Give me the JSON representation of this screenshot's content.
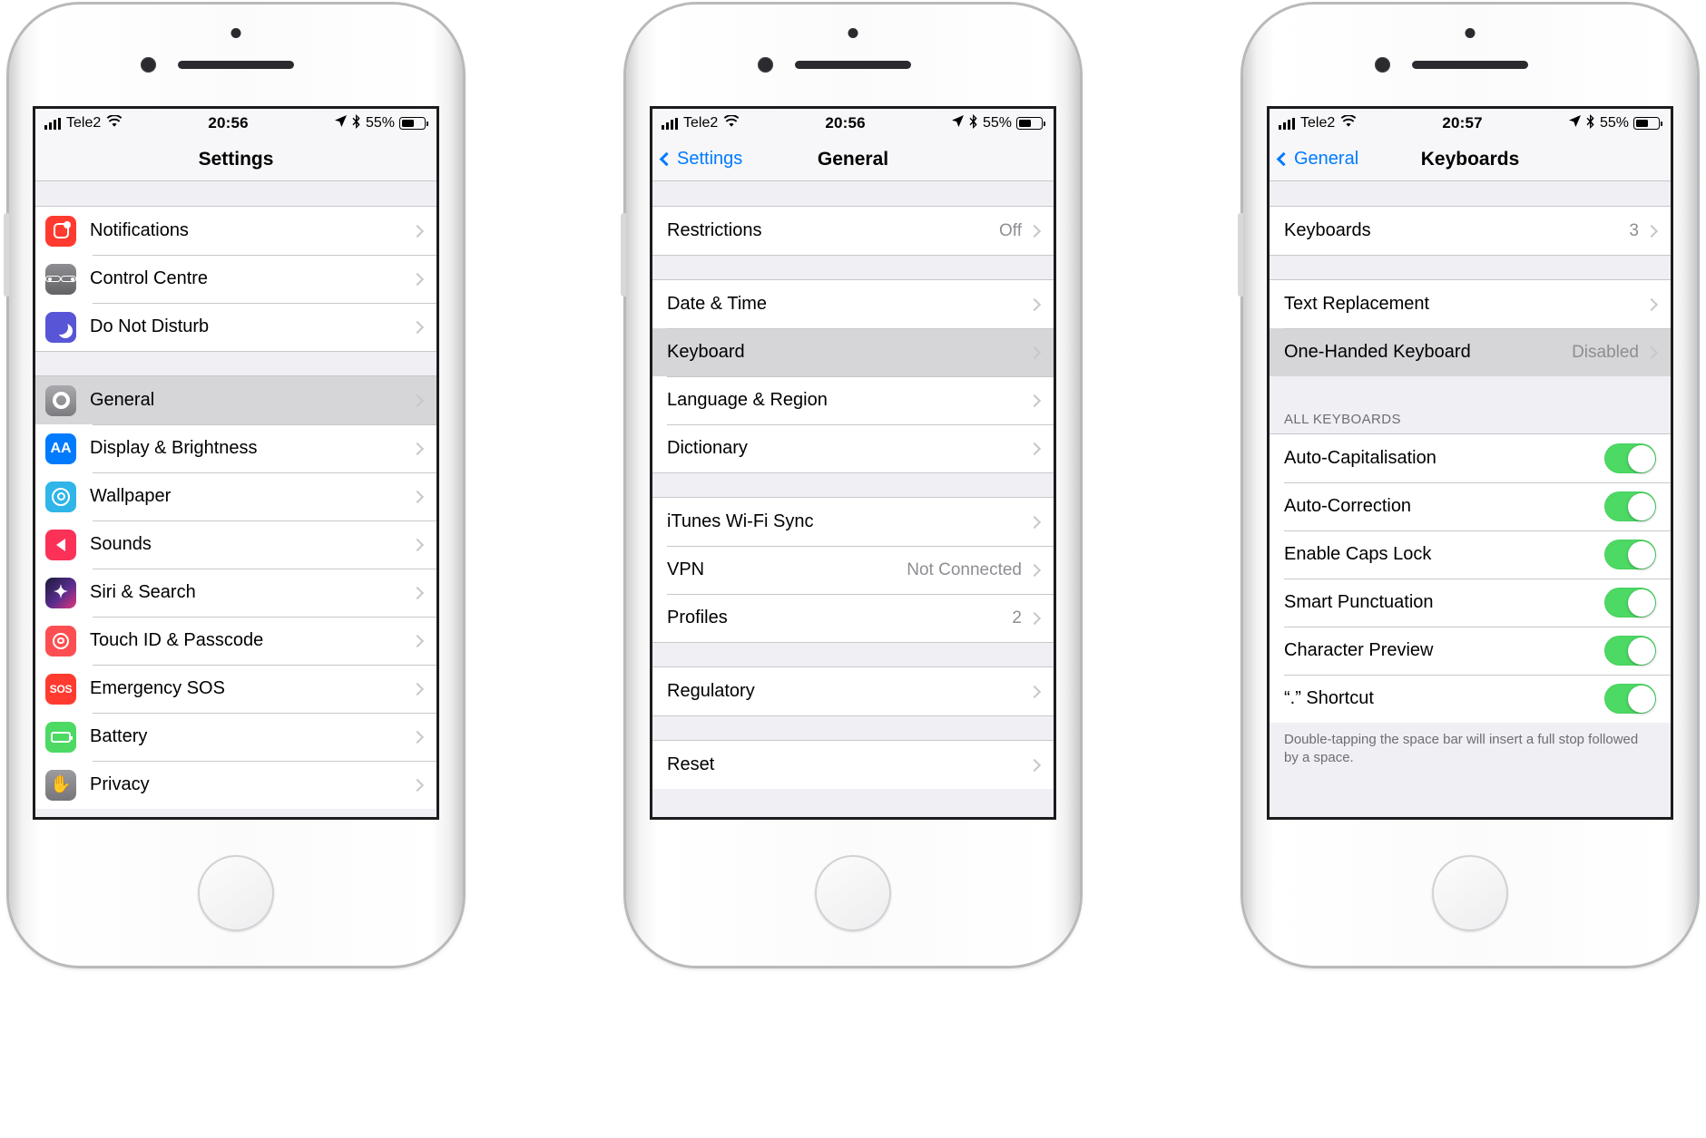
{
  "phones": [
    {
      "id": "settings",
      "status": {
        "carrier": "Tele2",
        "time": "20:56",
        "battery_pct": "55%",
        "signal_icon": "signal-bars-icon",
        "wifi_icon": "wifi-icon",
        "location_icon": "location-arrow-icon",
        "bluetooth_icon": "bluetooth-icon",
        "battery_icon": "battery-icon"
      },
      "nav": {
        "title": "Settings",
        "back_label": ""
      },
      "sections": [
        {
          "rows": [
            {
              "label": "Notifications",
              "icon": "notifications-icon",
              "icon_class": "ic-notif",
              "value": "",
              "chevron": true
            },
            {
              "label": "Control Centre",
              "icon": "control-centre-icon",
              "icon_class": "ic-control",
              "value": "",
              "chevron": true
            },
            {
              "label": "Do Not Disturb",
              "icon": "do-not-disturb-icon",
              "icon_class": "ic-dnd",
              "value": "",
              "chevron": true
            }
          ]
        },
        {
          "rows": [
            {
              "label": "General",
              "icon": "general-gear-icon",
              "icon_class": "ic-general",
              "value": "",
              "chevron": true,
              "selected": true
            },
            {
              "label": "Display & Brightness",
              "icon": "display-brightness-icon",
              "icon_class": "ic-display",
              "value": "",
              "chevron": true
            },
            {
              "label": "Wallpaper",
              "icon": "wallpaper-icon",
              "icon_class": "ic-wall",
              "value": "",
              "chevron": true
            },
            {
              "label": "Sounds",
              "icon": "sounds-icon",
              "icon_class": "ic-sounds",
              "value": "",
              "chevron": true
            },
            {
              "label": "Siri & Search",
              "icon": "siri-search-icon",
              "icon_class": "ic-siri",
              "value": "",
              "chevron": true
            },
            {
              "label": "Touch ID & Passcode",
              "icon": "touch-id-icon",
              "icon_class": "ic-touch",
              "value": "",
              "chevron": true
            },
            {
              "label": "Emergency SOS",
              "icon": "emergency-sos-icon",
              "icon_class": "ic-sos",
              "value": "",
              "chevron": true
            },
            {
              "label": "Battery",
              "icon": "battery-settings-icon",
              "icon_class": "ic-battery",
              "value": "",
              "chevron": true
            },
            {
              "label": "Privacy",
              "icon": "privacy-hand-icon",
              "icon_class": "ic-privacy",
              "value": "",
              "chevron": true
            }
          ]
        }
      ]
    },
    {
      "id": "general",
      "status": {
        "carrier": "Tele2",
        "time": "20:56",
        "battery_pct": "55%"
      },
      "nav": {
        "title": "General",
        "back_label": "Settings"
      },
      "sections": [
        {
          "rows": [
            {
              "label": "Restrictions",
              "value": "Off",
              "chevron": true
            }
          ]
        },
        {
          "rows": [
            {
              "label": "Date & Time",
              "value": "",
              "chevron": true
            },
            {
              "label": "Keyboard",
              "value": "",
              "chevron": true,
              "selected": true
            },
            {
              "label": "Language & Region",
              "value": "",
              "chevron": true
            },
            {
              "label": "Dictionary",
              "value": "",
              "chevron": true
            }
          ]
        },
        {
          "rows": [
            {
              "label": "iTunes Wi-Fi Sync",
              "value": "",
              "chevron": true
            },
            {
              "label": "VPN",
              "value": "Not Connected",
              "chevron": true
            },
            {
              "label": "Profiles",
              "value": "2",
              "chevron": true
            }
          ]
        },
        {
          "rows": [
            {
              "label": "Regulatory",
              "value": "",
              "chevron": true
            }
          ]
        },
        {
          "rows": [
            {
              "label": "Reset",
              "value": "",
              "chevron": true
            }
          ]
        }
      ]
    },
    {
      "id": "keyboards",
      "status": {
        "carrier": "Tele2",
        "time": "20:57",
        "battery_pct": "55%"
      },
      "nav": {
        "title": "Keyboards",
        "back_label": "General"
      },
      "sections": [
        {
          "rows": [
            {
              "label": "Keyboards",
              "value": "3",
              "chevron": true
            }
          ]
        },
        {
          "rows": [
            {
              "label": "Text Replacement",
              "value": "",
              "chevron": true
            },
            {
              "label": "One-Handed Keyboard",
              "value": "Disabled",
              "chevron": true,
              "selected": true
            }
          ]
        },
        {
          "header": "ALL KEYBOARDS",
          "rows": [
            {
              "label": "Auto-Capitalisation",
              "toggle": true,
              "toggle_on": true
            },
            {
              "label": "Auto-Correction",
              "toggle": true,
              "toggle_on": true
            },
            {
              "label": "Enable Caps Lock",
              "toggle": true,
              "toggle_on": true
            },
            {
              "label": "Smart Punctuation",
              "toggle": true,
              "toggle_on": true
            },
            {
              "label": "Character Preview",
              "toggle": true,
              "toggle_on": true
            },
            {
              "label": "“.” Shortcut",
              "toggle": true,
              "toggle_on": true
            }
          ],
          "footer": "Double-tapping the space bar will insert a full stop followed by a space."
        }
      ]
    }
  ],
  "colors": {
    "toggle_on": "#4cd964",
    "tint": "#007aff",
    "separator": "#c8c7cc",
    "group_bg": "#efeff4",
    "selected_row": "#d6d6d8",
    "secondary_text": "#8e8e93"
  }
}
